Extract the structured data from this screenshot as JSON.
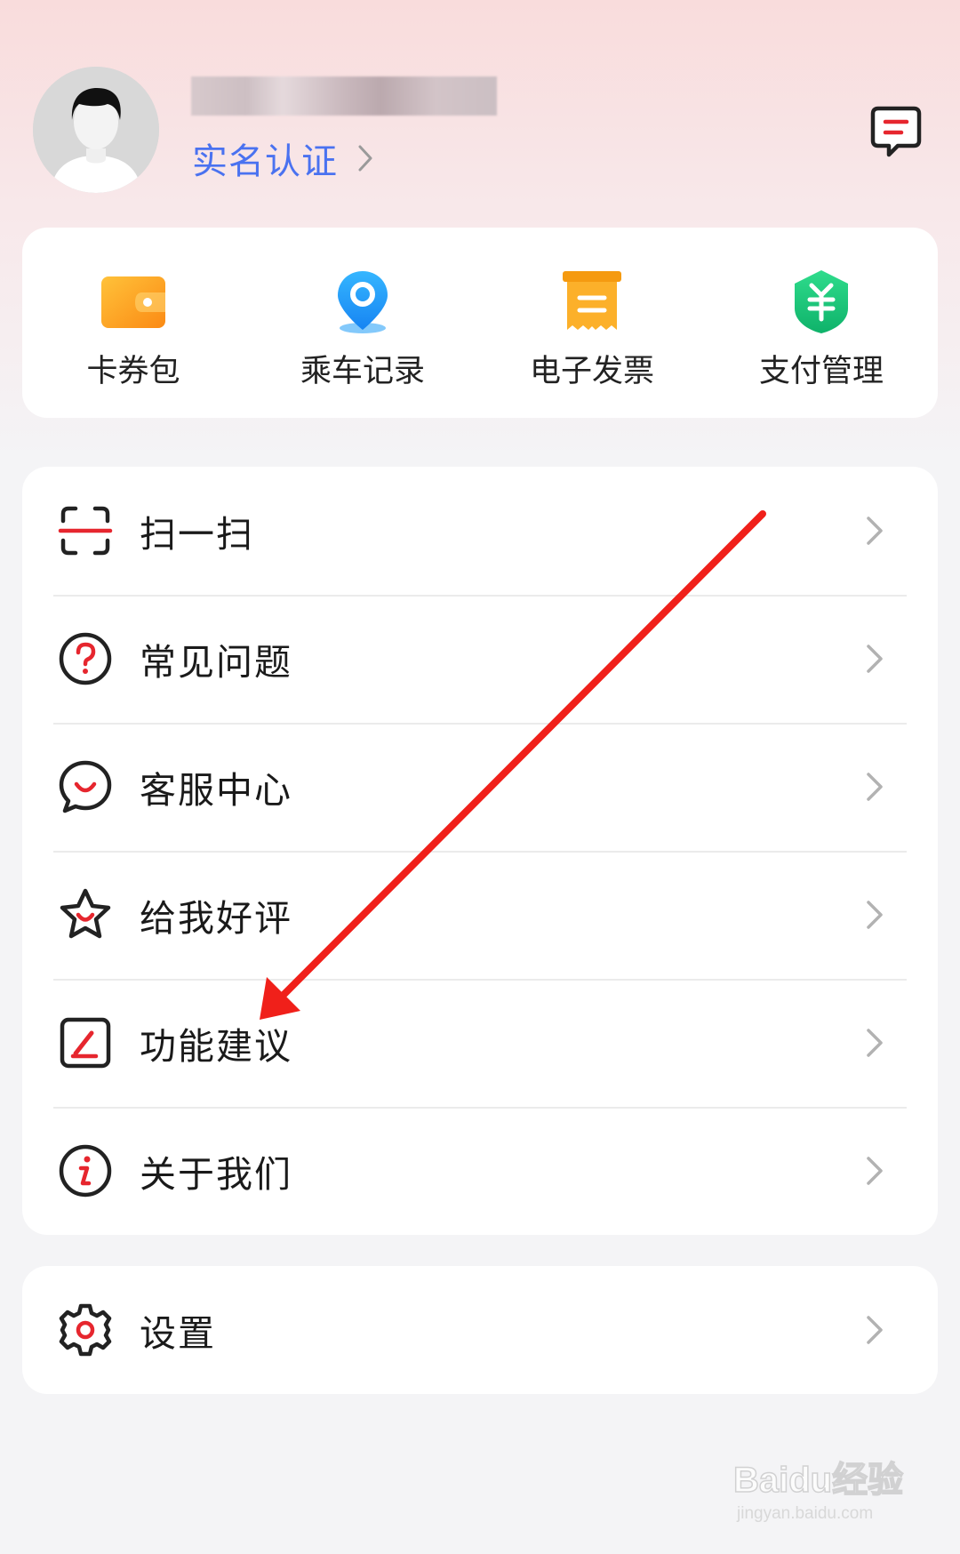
{
  "profile": {
    "verify_label": "实名认证"
  },
  "quick_actions": [
    {
      "label": "卡券包",
      "icon": "wallet-icon"
    },
    {
      "label": "乘车记录",
      "icon": "location-pin-icon"
    },
    {
      "label": "电子发票",
      "icon": "invoice-icon"
    },
    {
      "label": "支付管理",
      "icon": "payment-shield-icon"
    }
  ],
  "menu": [
    {
      "label": "扫一扫",
      "icon": "scan-icon"
    },
    {
      "label": "常见问题",
      "icon": "question-icon"
    },
    {
      "label": "客服中心",
      "icon": "customer-service-icon"
    },
    {
      "label": "给我好评",
      "icon": "star-rating-icon"
    },
    {
      "label": "功能建议",
      "icon": "feedback-edit-icon"
    },
    {
      "label": "关于我们",
      "icon": "info-icon"
    }
  ],
  "settings": {
    "label": "设置",
    "icon": "gear-icon"
  },
  "colors": {
    "accent_red": "#e6262e",
    "link_blue": "#4a72f0",
    "wallet_orange": "#fb9a1e",
    "pin_blue": "#1e9cf7",
    "invoice_orange": "#fba21c",
    "payment_green": "#16c27a"
  },
  "watermark": {
    "brand": "Baidu经验",
    "url": "jingyan.baidu.com"
  }
}
